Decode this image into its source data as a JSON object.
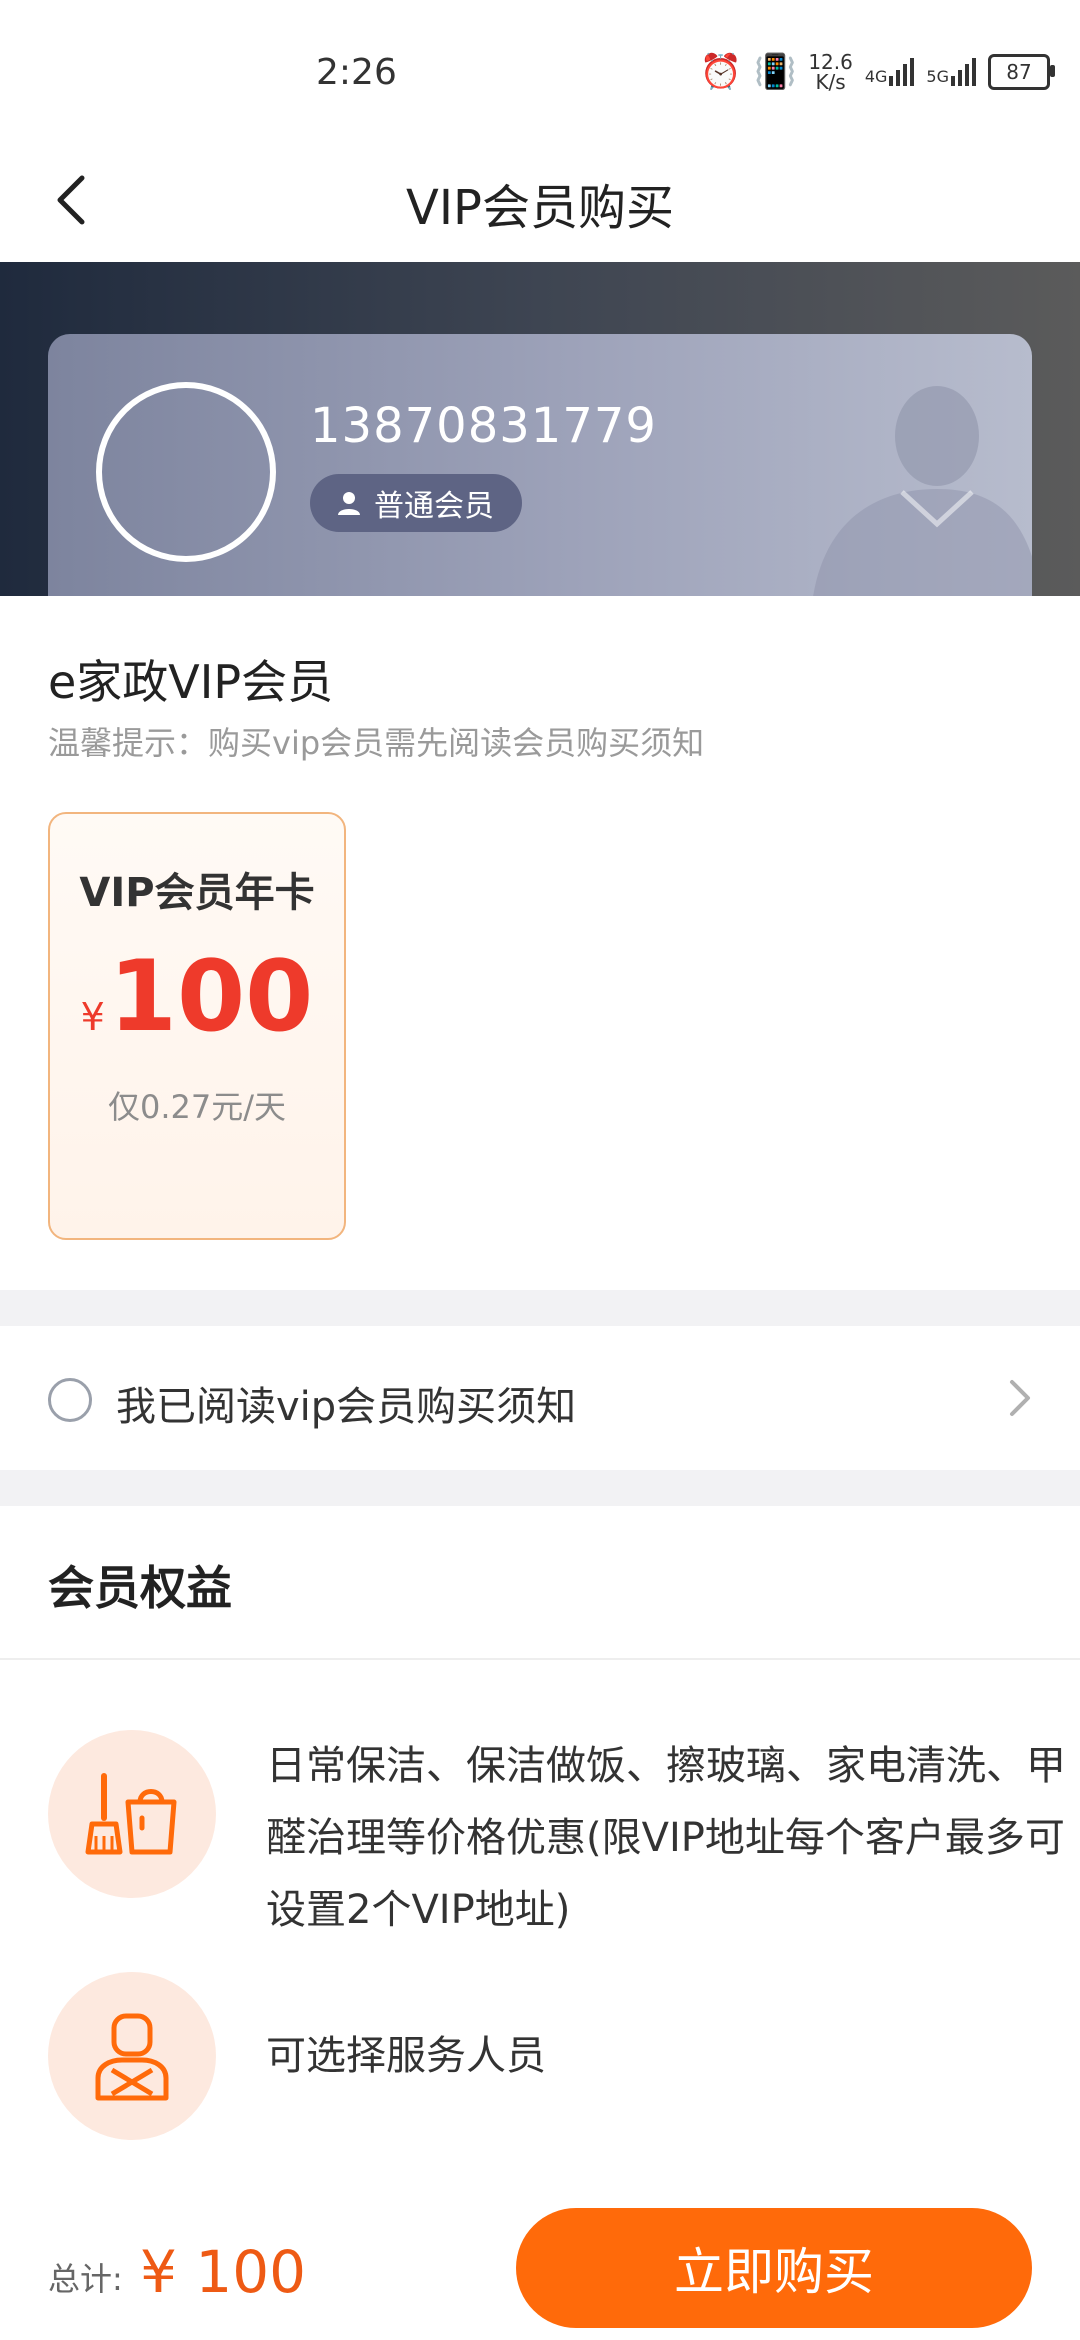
{
  "status_bar": {
    "time": "2:26",
    "net_speed_value": "12.6",
    "net_speed_unit": "K/s",
    "signal1_label": "4G",
    "signal2_label": "5G",
    "battery": "87",
    "icons": [
      "alarm-icon",
      "vibrate-icon",
      "signal-icon",
      "signal-icon",
      "battery-icon"
    ]
  },
  "nav": {
    "title": "VIP会员购买"
  },
  "profile": {
    "phone": "13870831779",
    "member_level": "普通会员"
  },
  "main": {
    "section_title": "e家政VIP会员",
    "tip": "温馨提示：购买vip会员需先阅读会员购买须知",
    "plan": {
      "name": "VIP会员年卡",
      "currency": "¥",
      "price": "100",
      "daily": "仅0.27元/天"
    },
    "agreement_text": "我已阅读vip会员购买须知",
    "benefits_title": "会员权益",
    "benefits": [
      {
        "icon": "cleaning-icon",
        "text": "日常保洁、保洁做饭、擦玻璃、家电清洗、甲醛治理等价格优惠(限VIP地址每个客户最多可设置2个VIP地址)"
      },
      {
        "icon": "staff-icon",
        "text": "可选择服务人员"
      }
    ]
  },
  "bottom": {
    "total_label": "总计:",
    "total_amount": "¥ 100",
    "buy_label": "立即购买"
  },
  "colors": {
    "accent": "#ff6a0a",
    "price_red": "#ee3a2b",
    "badge_bg": "#5e6484"
  }
}
